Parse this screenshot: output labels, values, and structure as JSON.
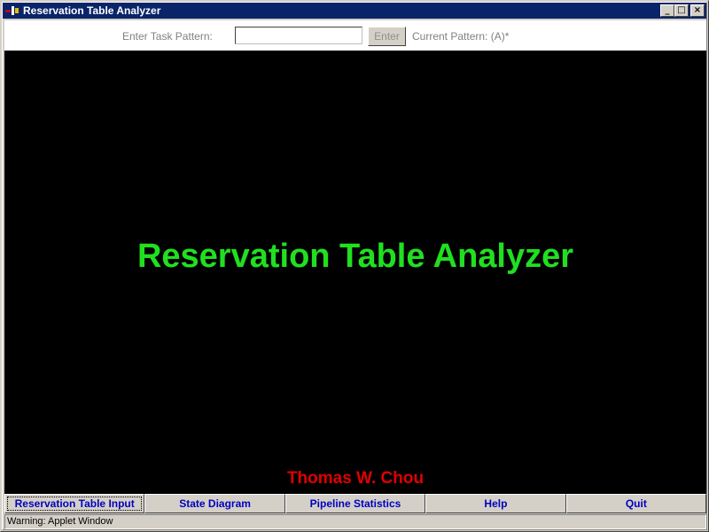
{
  "window": {
    "title": "Reservation Table Analyzer",
    "buttons": {
      "minimize": "_",
      "maximize": "□",
      "close": "×"
    }
  },
  "inputbar": {
    "label": "Enter Task Pattern:",
    "field_value": "",
    "enter_label": "Enter",
    "current_pattern": "Current Pattern: (A)*"
  },
  "canvas": {
    "title": "Reservation Table Analyzer",
    "author": "Thomas W. Chou",
    "title_color": "#20e020",
    "author_color": "#e00000"
  },
  "tabs": [
    {
      "label": "Reservation Table Input",
      "active": true
    },
    {
      "label": "State Diagram",
      "active": false
    },
    {
      "label": "Pipeline Statistics",
      "active": false
    },
    {
      "label": "Help",
      "active": false
    },
    {
      "label": "Quit",
      "active": false
    }
  ],
  "statusbar": {
    "text": "Warning: Applet Window"
  },
  "icons": {
    "app": "java-applet-icon"
  }
}
